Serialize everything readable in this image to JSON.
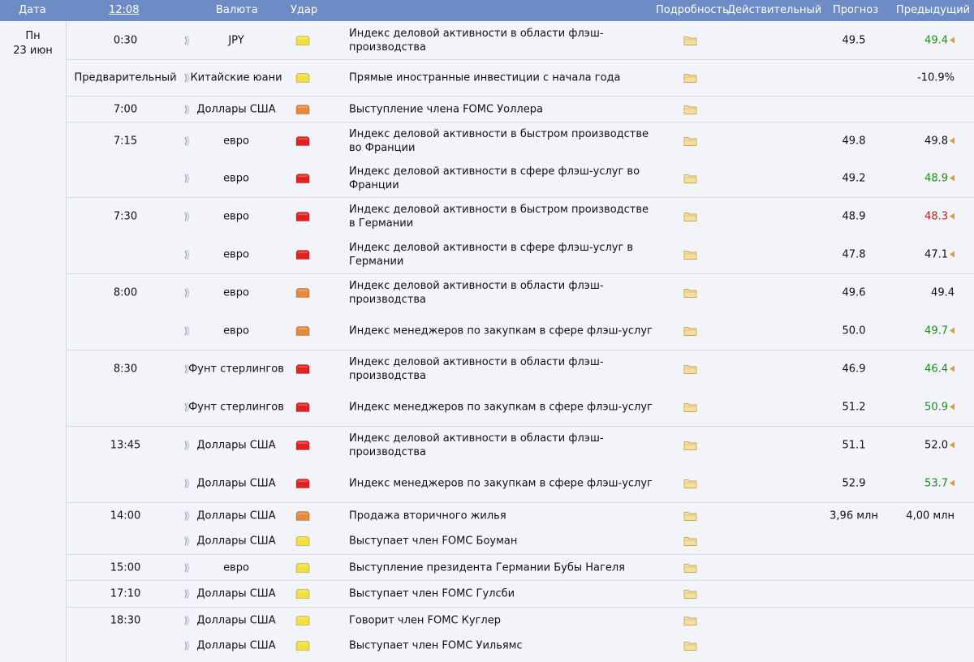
{
  "header": {
    "date": "Дата",
    "time": "12:08",
    "currency": "Валюта",
    "impact": "Удар",
    "detail": "Подробность",
    "actual": "Действительный",
    "forecast": "Прогноз",
    "previous": "Предыдущий"
  },
  "day": {
    "weekday": "Пн",
    "date": "23 июн"
  },
  "colors": {
    "high": "#e52020",
    "medium": "#e8893a",
    "low": "#f3e03a",
    "up": "#1e8c1e",
    "down": "#c82020"
  },
  "rows": [
    {
      "time": "0:30",
      "currency": "JPY",
      "impact": "low",
      "event": "Индекс деловой активности в области флэш-производства",
      "actual": "",
      "forecast": "49.5",
      "previous": "49.4",
      "prev_color": "green",
      "prev_arrow": true
    },
    {
      "time": "Предварительный",
      "currency": "Китайские юани",
      "impact": "low",
      "event": "Прямые иностранные инвестиции с начала года",
      "actual": "",
      "forecast": "",
      "previous": "-10.9%",
      "prev_color": "",
      "prev_arrow": false
    },
    {
      "time": "7:00",
      "currency": "Доллары США",
      "impact": "medium",
      "event": "Выступление члена FOMC Уоллера",
      "actual": "",
      "forecast": "",
      "previous": "",
      "prev_color": "",
      "prev_arrow": false
    },
    {
      "time": "7:15",
      "currency": "евро",
      "impact": "high",
      "event": "Индекс деловой активности в быстром производстве во Франции",
      "actual": "",
      "forecast": "49.8",
      "previous": "49.8",
      "prev_color": "",
      "prev_arrow": true
    },
    {
      "time": "",
      "currency": "евро",
      "impact": "high",
      "event": "Индекс деловой активности в сфере флэш-услуг во Франции",
      "actual": "",
      "forecast": "49.2",
      "previous": "48.9",
      "prev_color": "green",
      "prev_arrow": true
    },
    {
      "time": "7:30",
      "currency": "евро",
      "impact": "high",
      "event": "Индекс деловой активности в быстром производстве в Германии",
      "actual": "",
      "forecast": "48.9",
      "previous": "48.3",
      "prev_color": "red",
      "prev_arrow": true
    },
    {
      "time": "",
      "currency": "евро",
      "impact": "high",
      "event": "Индекс деловой активности в сфере флэш-услуг в Германии",
      "actual": "",
      "forecast": "47.8",
      "previous": "47.1",
      "prev_color": "",
      "prev_arrow": true
    },
    {
      "time": "8:00",
      "currency": "евро",
      "impact": "medium",
      "event": "Индекс деловой активности в области флэш-производства",
      "actual": "",
      "forecast": "49.6",
      "previous": "49.4",
      "prev_color": "",
      "prev_arrow": false
    },
    {
      "time": "",
      "currency": "евро",
      "impact": "medium",
      "event": "Индекс менеджеров по закупкам в сфере флэш-услуг",
      "actual": "",
      "forecast": "50.0",
      "previous": "49.7",
      "prev_color": "green",
      "prev_arrow": true
    },
    {
      "time": "8:30",
      "currency": "Фунт стерлингов",
      "impact": "high",
      "event": "Индекс деловой активности в области флэш-производства",
      "actual": "",
      "forecast": "46.9",
      "previous": "46.4",
      "prev_color": "green",
      "prev_arrow": true
    },
    {
      "time": "",
      "currency": "Фунт стерлингов",
      "impact": "high",
      "event": "Индекс менеджеров по закупкам в сфере флэш-услуг",
      "actual": "",
      "forecast": "51.2",
      "previous": "50.9",
      "prev_color": "green",
      "prev_arrow": true
    },
    {
      "time": "13:45",
      "currency": "Доллары США",
      "impact": "high",
      "event": "Индекс деловой активности в области флэш-производства",
      "actual": "",
      "forecast": "51.1",
      "previous": "52.0",
      "prev_color": "",
      "prev_arrow": true
    },
    {
      "time": "",
      "currency": "Доллары США",
      "impact": "high",
      "event": "Индекс менеджеров по закупкам в сфере флэш-услуг",
      "actual": "",
      "forecast": "52.9",
      "previous": "53.7",
      "prev_color": "green",
      "prev_arrow": true
    },
    {
      "time": "14:00",
      "currency": "Доллары США",
      "impact": "medium",
      "event": "Продажа вторичного жилья",
      "actual": "",
      "forecast": "3,96 млн",
      "previous": "4,00 млн",
      "prev_color": "",
      "prev_arrow": false
    },
    {
      "time": "",
      "currency": "Доллары США",
      "impact": "low",
      "event": "Выступает член FOMC Боуман",
      "actual": "",
      "forecast": "",
      "previous": "",
      "prev_color": "",
      "prev_arrow": false
    },
    {
      "time": "15:00",
      "currency": "евро",
      "impact": "low",
      "event": "Выступление президента Германии Бубы Нагеля",
      "actual": "",
      "forecast": "",
      "previous": "",
      "prev_color": "",
      "prev_arrow": false
    },
    {
      "time": "17:10",
      "currency": "Доллары США",
      "impact": "low",
      "event": "Выступает член FOMC Гулсби",
      "actual": "",
      "forecast": "",
      "previous": "",
      "prev_color": "",
      "prev_arrow": false
    },
    {
      "time": "18:30",
      "currency": "Доллары США",
      "impact": "low",
      "event": "Говорит член FOMC Куглер",
      "actual": "",
      "forecast": "",
      "previous": "",
      "prev_color": "",
      "prev_arrow": false
    },
    {
      "time": "",
      "currency": "Доллары США",
      "impact": "low",
      "event": "Выступает член FOMC Уильямс",
      "actual": "",
      "forecast": "",
      "previous": "",
      "prev_color": "",
      "prev_arrow": false
    }
  ]
}
